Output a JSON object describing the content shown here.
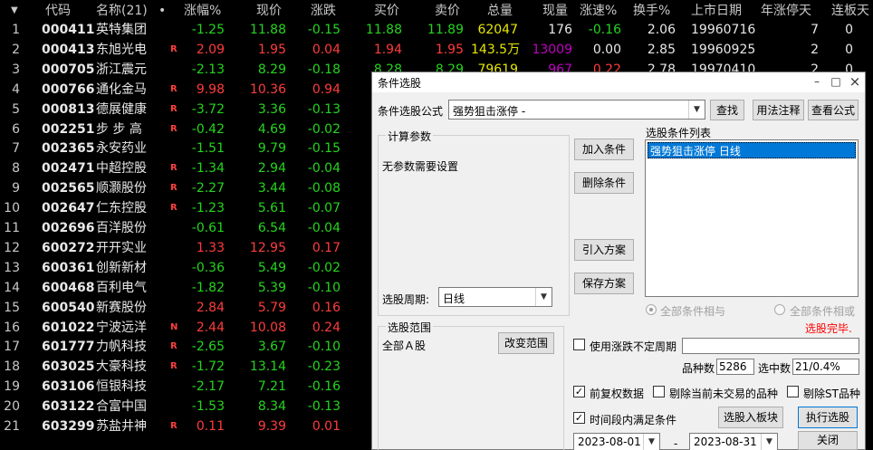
{
  "header": {
    "sort_icon": "▼",
    "cols": [
      "代码",
      "名称(21)",
      "•",
      "涨幅%",
      "现价",
      "涨跌",
      "买价",
      "卖价",
      "总量",
      "现量",
      "涨速%",
      "换手%",
      "上市日期",
      "年涨停天",
      "连板天"
    ]
  },
  "rows": [
    {
      "i": "1",
      "code": "000411",
      "name": "英特集团",
      "flag": "",
      "chg_pct": "-1.25",
      "price": "11.88",
      "chg": "-0.15",
      "bid": "11.88",
      "ask": "11.89",
      "vol": "62047",
      "cur": "176",
      "spd": "-0.16",
      "turn": "2.06",
      "date": "19960716",
      "lim": "7",
      "cons": "0",
      "cp": "green",
      "cpr": "green",
      "cb": "green",
      "ca": "green",
      "cc": "white",
      "cs": "green"
    },
    {
      "i": "2",
      "code": "000413",
      "name": "东旭光电",
      "flag": "R",
      "chg_pct": "2.09",
      "price": "1.95",
      "chg": "0.04",
      "bid": "1.94",
      "ask": "1.95",
      "vol": "143.5万",
      "cur": "13009",
      "spd": "0.00",
      "turn": "2.85",
      "date": "19960925",
      "lim": "2",
      "cons": "0",
      "cp": "red",
      "cpr": "red",
      "cb": "red",
      "ca": "red",
      "cc": "purple",
      "cs": "white"
    },
    {
      "i": "3",
      "code": "000705",
      "name": "浙江震元",
      "flag": "",
      "chg_pct": "-2.13",
      "price": "8.29",
      "chg": "-0.18",
      "bid": "8.28",
      "ask": "8.29",
      "vol": "79619",
      "cur": "967",
      "spd": "0.22",
      "turn": "2.78",
      "date": "19970410",
      "lim": "2",
      "cons": "0",
      "cp": "green",
      "cpr": "green",
      "cb": "green",
      "ca": "green",
      "cc": "purple",
      "cs": "red"
    },
    {
      "i": "4",
      "code": "000766",
      "name": "通化金马",
      "flag": "R",
      "chg_pct": "9.98",
      "price": "10.36",
      "chg": "0.94",
      "cp": "red",
      "cpr": "red"
    },
    {
      "i": "5",
      "code": "000813",
      "name": "德展健康",
      "flag": "R",
      "chg_pct": "-3.72",
      "price": "3.36",
      "chg": "-0.13",
      "cp": "green",
      "cpr": "green"
    },
    {
      "i": "6",
      "code": "002251",
      "name": "步 步 高",
      "flag": "R",
      "chg_pct": "-0.42",
      "price": "4.69",
      "chg": "-0.02",
      "cp": "green",
      "cpr": "green"
    },
    {
      "i": "7",
      "code": "002365",
      "name": "永安药业",
      "flag": "",
      "chg_pct": "-1.51",
      "price": "9.79",
      "chg": "-0.15",
      "cp": "green",
      "cpr": "green"
    },
    {
      "i": "8",
      "code": "002471",
      "name": "中超控股",
      "flag": "R",
      "chg_pct": "-1.34",
      "price": "2.94",
      "chg": "-0.04",
      "cp": "green",
      "cpr": "green"
    },
    {
      "i": "9",
      "code": "002565",
      "name": "顺灏股份",
      "flag": "R",
      "chg_pct": "-2.27",
      "price": "3.44",
      "chg": "-0.08",
      "cp": "green",
      "cpr": "green"
    },
    {
      "i": "10",
      "code": "002647",
      "name": "仁东控股",
      "flag": "R",
      "chg_pct": "-1.23",
      "price": "5.61",
      "chg": "-0.07",
      "cp": "green",
      "cpr": "green"
    },
    {
      "i": "11",
      "code": "002696",
      "name": "百洋股份",
      "flag": "",
      "chg_pct": "-0.61",
      "price": "6.54",
      "chg": "-0.04",
      "cp": "green",
      "cpr": "green"
    },
    {
      "i": "12",
      "code": "600272",
      "name": "开开实业",
      "flag": "",
      "chg_pct": "1.33",
      "price": "12.95",
      "chg": "0.17",
      "cp": "red",
      "cpr": "red"
    },
    {
      "i": "13",
      "code": "600361",
      "name": "创新新材",
      "flag": "",
      "chg_pct": "-0.36",
      "price": "5.49",
      "chg": "-0.02",
      "cp": "green",
      "cpr": "green"
    },
    {
      "i": "14",
      "code": "600468",
      "name": "百利电气",
      "flag": "",
      "chg_pct": "-1.82",
      "price": "5.39",
      "chg": "-0.10",
      "cp": "green",
      "cpr": "green"
    },
    {
      "i": "15",
      "code": "600540",
      "name": "新赛股份",
      "flag": "",
      "chg_pct": "2.84",
      "price": "5.79",
      "chg": "0.16",
      "cp": "red",
      "cpr": "red"
    },
    {
      "i": "16",
      "code": "601022",
      "name": "宁波远洋",
      "flag": "N",
      "chg_pct": "2.44",
      "price": "10.08",
      "chg": "0.24",
      "cp": "red",
      "cpr": "red"
    },
    {
      "i": "17",
      "code": "601777",
      "name": "力帆科技",
      "flag": "R",
      "chg_pct": "-2.65",
      "price": "3.67",
      "chg": "-0.10",
      "cp": "green",
      "cpr": "green"
    },
    {
      "i": "18",
      "code": "603025",
      "name": "大豪科技",
      "flag": "R",
      "chg_pct": "-1.72",
      "price": "13.14",
      "chg": "-0.23",
      "cp": "green",
      "cpr": "green"
    },
    {
      "i": "19",
      "code": "603106",
      "name": "恒银科技",
      "flag": "",
      "chg_pct": "-2.17",
      "price": "7.21",
      "chg": "-0.16",
      "cp": "green",
      "cpr": "green"
    },
    {
      "i": "20",
      "code": "603122",
      "name": "合富中国",
      "flag": "",
      "chg_pct": "-1.53",
      "price": "8.34",
      "chg": "-0.13",
      "cp": "green",
      "cpr": "green"
    },
    {
      "i": "21",
      "code": "603299",
      "name": "苏盐井神",
      "flag": "R",
      "chg_pct": "0.11",
      "price": "9.39",
      "chg": "0.01",
      "cp": "red",
      "cpr": "red"
    }
  ],
  "dialog": {
    "title": "条件选股",
    "minimize": "–",
    "maximize": "□",
    "close": "×",
    "formula_label": "条件选股公式",
    "formula_value": "强势狙击涨停 -",
    "btn_find": "查找",
    "btn_usage": "用法注释",
    "btn_view": "查看公式",
    "params_group": "计算参数",
    "params_text": "无参数需要设置",
    "btn_add": "加入条件",
    "btn_delete": "删除条件",
    "btn_import": "引入方案",
    "btn_save": "保存方案",
    "list_title": "选股条件列表",
    "list_item": "强势狙击涨停  日线",
    "period_label": "选股周期:",
    "period_value": "日线",
    "radio_and": "全部条件相与",
    "radio_or": "全部条件相或",
    "status": "选股完毕.",
    "scope_group": "选股范围",
    "scope_value": "全部Ａ股",
    "btn_scope": "改变范围",
    "chk_period": "使用涨跌不定周期",
    "count_label": "品种数",
    "count_value": "5286",
    "selected_label": "选中数",
    "selected_value": "21/0.4%",
    "chk_prefq": "前复权数据",
    "chk_exclude_notrade": "剔除当前未交易的品种",
    "chk_exclude_st": "剔除ST品种",
    "chk_timerange": "时间段内满足条件",
    "btn_to_block": "选股入板块",
    "btn_execute": "执行选股",
    "date_from": "2023-08-01",
    "date_sep": "-",
    "date_to": "2023-08-31",
    "btn_close": "关闭",
    "check_mark": "✓",
    "arrow": "▼"
  },
  "colors": {
    "up": "#ff3c3c",
    "down": "#25d41e",
    "accent": "#0078d7",
    "status": "#ff0000"
  }
}
